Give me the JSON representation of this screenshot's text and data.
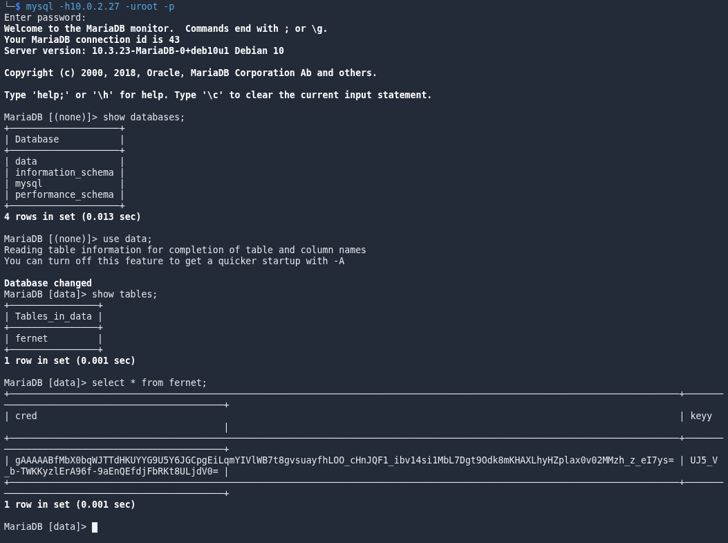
{
  "terminal": {
    "lines": [
      {
        "kind": "shell",
        "corner": "└─",
        "sign": "$",
        "command": "mysql -h10.0.2.27 -uroot -p"
      },
      {
        "kind": "output",
        "text": "Enter password:"
      },
      {
        "kind": "bold",
        "text": "Welcome to the MariaDB monitor.  Commands end with ; or \\g."
      },
      {
        "kind": "bold",
        "text": "Your MariaDB connection id is 43"
      },
      {
        "kind": "bold",
        "text": "Server version: 10.3.23-MariaDB-0+deb10u1 Debian 10"
      },
      {
        "kind": "blank"
      },
      {
        "kind": "bold",
        "text": "Copyright (c) 2000, 2018, Oracle, MariaDB Corporation Ab and others."
      },
      {
        "kind": "blank"
      },
      {
        "kind": "bold",
        "text": "Type 'help;' or '\\h' for help. Type '\\c' to clear the current input statement."
      },
      {
        "kind": "blank"
      },
      {
        "kind": "prompt",
        "text": "MariaDB [(none)]> show databases;",
        "cursor": false
      },
      {
        "kind": "border",
        "text": "+────────────────────+"
      },
      {
        "kind": "output",
        "text": "| Database           |"
      },
      {
        "kind": "border",
        "text": "+────────────────────+"
      },
      {
        "kind": "output",
        "text": "| data               |"
      },
      {
        "kind": "output",
        "text": "| information_schema |"
      },
      {
        "kind": "output",
        "text": "| mysql              |"
      },
      {
        "kind": "output",
        "text": "| performance_schema |"
      },
      {
        "kind": "border",
        "text": "+────────────────────+"
      },
      {
        "kind": "bold",
        "text": "4 rows in set (0.013 sec)"
      },
      {
        "kind": "blank"
      },
      {
        "kind": "prompt",
        "text": "MariaDB [(none)]> use data;",
        "cursor": false
      },
      {
        "kind": "output",
        "text": "Reading table information for completion of table and column names"
      },
      {
        "kind": "output",
        "text": "You can turn off this feature to get a quicker startup with -A"
      },
      {
        "kind": "blank"
      },
      {
        "kind": "bold",
        "text": "Database changed"
      },
      {
        "kind": "prompt",
        "text": "MariaDB [data]> show tables;",
        "cursor": false
      },
      {
        "kind": "border",
        "text": "+────────────────+"
      },
      {
        "kind": "output",
        "text": "| Tables_in_data |"
      },
      {
        "kind": "border",
        "text": "+────────────────+"
      },
      {
        "kind": "output",
        "text": "| fernet         |"
      },
      {
        "kind": "border",
        "text": "+────────────────+"
      },
      {
        "kind": "bold",
        "text": "1 row in set (0.001 sec)"
      },
      {
        "kind": "blank"
      },
      {
        "kind": "prompt",
        "text": "MariaDB [data]> select * from fernet;",
        "cursor": false
      },
      {
        "kind": "border",
        "text": "+──────────────────────────────────────────────────────────────────────────────────────────────────────────────────────────+───────"
      },
      {
        "kind": "border",
        "text": "────────────────────────────────────────+"
      },
      {
        "kind": "output",
        "text": "| cred                                                                                                                     | keyy"
      },
      {
        "kind": "output",
        "text": "                                        |"
      },
      {
        "kind": "border",
        "text": "+──────────────────────────────────────────────────────────────────────────────────────────────────────────────────────────+───────"
      },
      {
        "kind": "border",
        "text": "────────────────────────────────────────+"
      },
      {
        "kind": "output",
        "text": "| gAAAAABfMbX0bqWJTTdHKUYYG9U5Y6JGCpgEiLqmYIVlWB7t8gvsuayfhLOO_cHnJQF1_ibv14si1MbL7Dgt9Odk8mKHAXLhyHZplax0v02MMzh_z_eI7ys= | UJ5_V"
      },
      {
        "kind": "output",
        "text": "_b-TWKKyzlErA96f-9aEnQEfdjFbRKt8ULjdV0= |"
      },
      {
        "kind": "border",
        "text": "+──────────────────────────────────────────────────────────────────────────────────────────────────────────────────────────+───────"
      },
      {
        "kind": "border",
        "text": "────────────────────────────────────────+"
      },
      {
        "kind": "bold",
        "text": "1 row in set (0.001 sec)"
      },
      {
        "kind": "blank"
      },
      {
        "kind": "prompt",
        "text": "MariaDB [data]> ",
        "cursor": true
      }
    ]
  }
}
